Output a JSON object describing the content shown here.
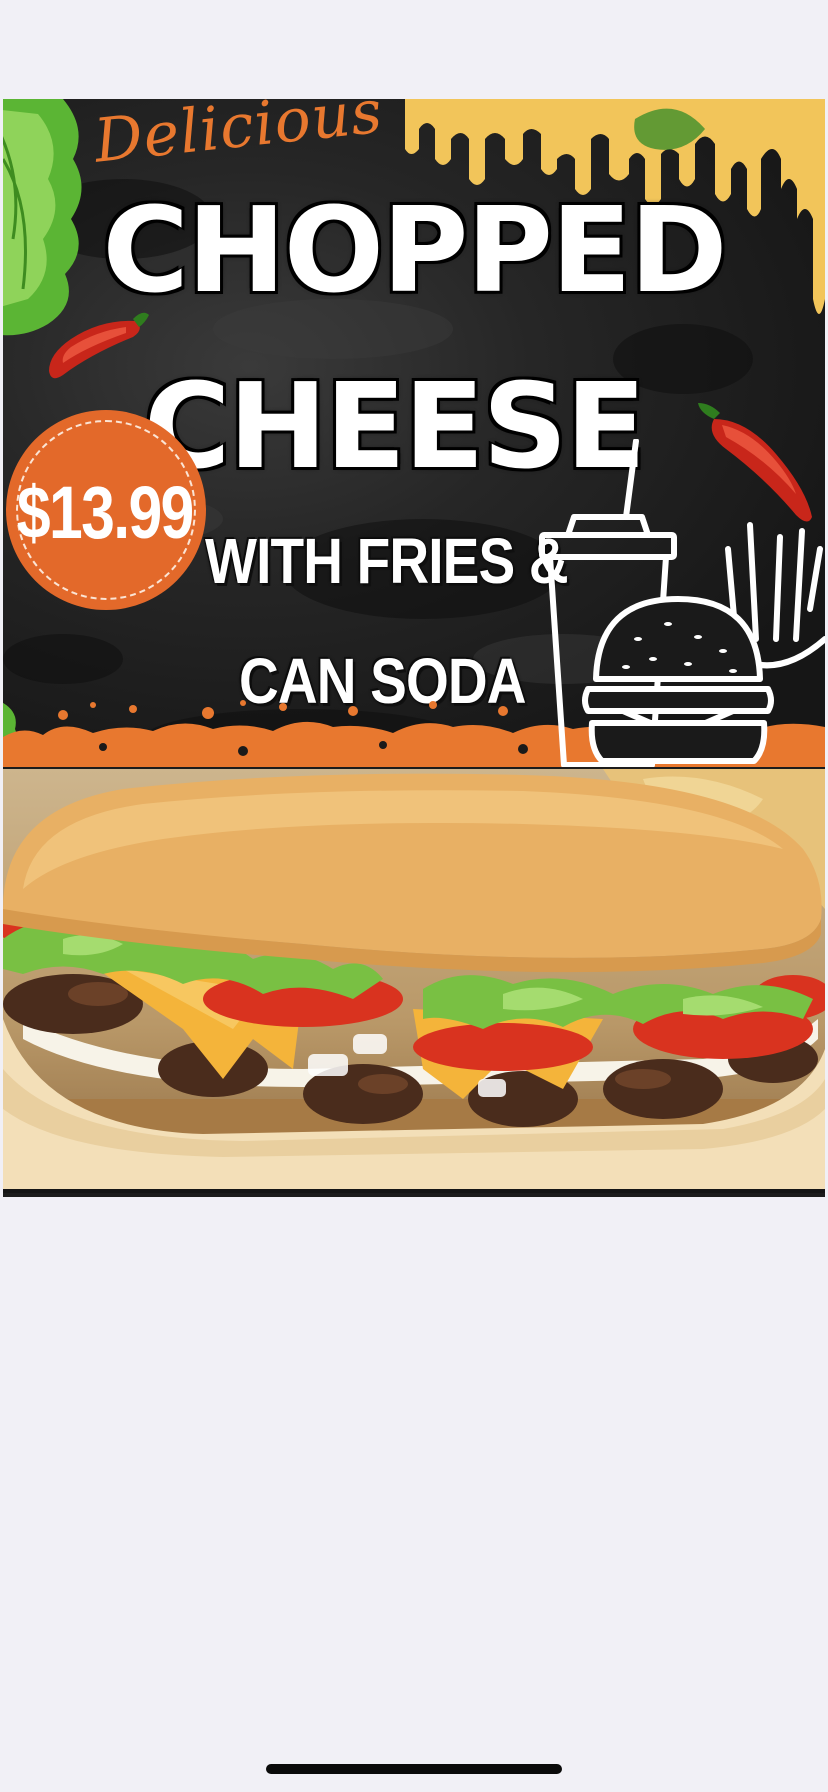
{
  "flyer": {
    "script_word": "Delicious",
    "title_line1": "CHOPPED",
    "title_line2": "CHEESE",
    "price": "$13.99",
    "combo_line1": "WITH FRIES &",
    "combo_line2": "CAN SODA",
    "icons": [
      "lettuce-icon",
      "chili-pepper-icon",
      "cheese-drip-icon",
      "soda-cup-icon",
      "burger-icon",
      "fries-icon"
    ],
    "colors": {
      "accent_orange": "#e3692a",
      "background_dark": "#1c1c1c",
      "cheese_yellow": "#f2c55a",
      "text_white": "#ffffff"
    }
  },
  "photo": {
    "icon": "sandwich-photo"
  },
  "system": {
    "home_indicator": "home-indicator"
  }
}
